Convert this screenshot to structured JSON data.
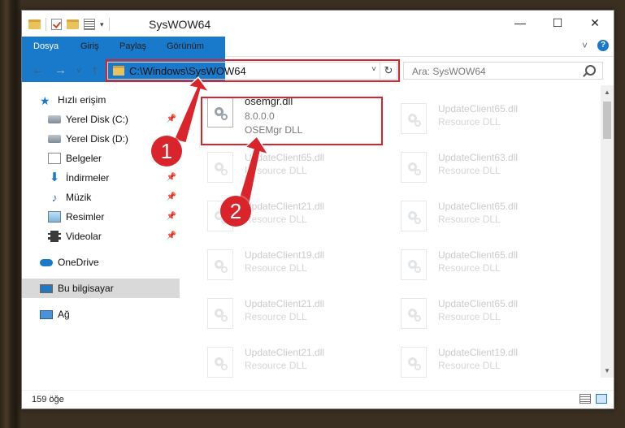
{
  "window": {
    "title": "SysWOW64",
    "minimize": "—",
    "maximize": "☐",
    "close": "✕"
  },
  "ribbon": {
    "tabs": [
      "Dosya",
      "Giriş",
      "Paylaş",
      "Görünüm"
    ],
    "collapse": "˅",
    "help": "?"
  },
  "nav": {
    "back": "←",
    "forward": "→",
    "recent": "˅",
    "up": "↑",
    "address": "C:\\Windows\\SysWOW64",
    "refresh": "↻",
    "search_placeholder": "Ara: SysWOW64"
  },
  "sidebar": {
    "items": [
      {
        "label": "Hızlı erişim"
      },
      {
        "label": "Yerel Disk (C:)"
      },
      {
        "label": "Yerel Disk (D:)"
      },
      {
        "label": "Belgeler"
      },
      {
        "label": "İndirmeler"
      },
      {
        "label": "Müzik"
      },
      {
        "label": "Resimler"
      },
      {
        "label": "Videolar"
      },
      {
        "label": "OneDrive"
      },
      {
        "label": "Bu bilgisayar"
      },
      {
        "label": "Ağ"
      }
    ]
  },
  "files": {
    "main": {
      "name": "osemgr.dll",
      "version": "8.0.0.0",
      "desc": "OSEMgr DLL"
    },
    "faded": [
      {
        "name": "UpdateClient65.dll",
        "desc": "Resource DLL"
      },
      {
        "name": "UpdateClient65.dll",
        "desc": "Resource DLL"
      },
      {
        "name": "UpdateClient63.dll",
        "desc": "Resource DLL"
      },
      {
        "name": "UpdateClient21.dll",
        "desc": "Resource DLL"
      },
      {
        "name": "UpdateClient65.dll",
        "desc": "Resource DLL"
      },
      {
        "name": "UpdateClient19.dll",
        "desc": "Resource DLL"
      },
      {
        "name": "UpdateClient65.dll",
        "desc": "Resource DLL"
      },
      {
        "name": "UpdateClient21.dll",
        "desc": "Resource DLL"
      },
      {
        "name": "UpdateClient65.dll",
        "desc": "Resource DLL"
      },
      {
        "name": "UpdateClient21.dll",
        "desc": "Resource DLL"
      },
      {
        "name": "UpdateClient19.dll",
        "desc": "Resource DLL"
      }
    ]
  },
  "status": {
    "count": "159 öğe"
  },
  "callouts": [
    "1",
    "2"
  ],
  "colors": {
    "accent": "#1979ca",
    "highlight": "#d9242b"
  }
}
